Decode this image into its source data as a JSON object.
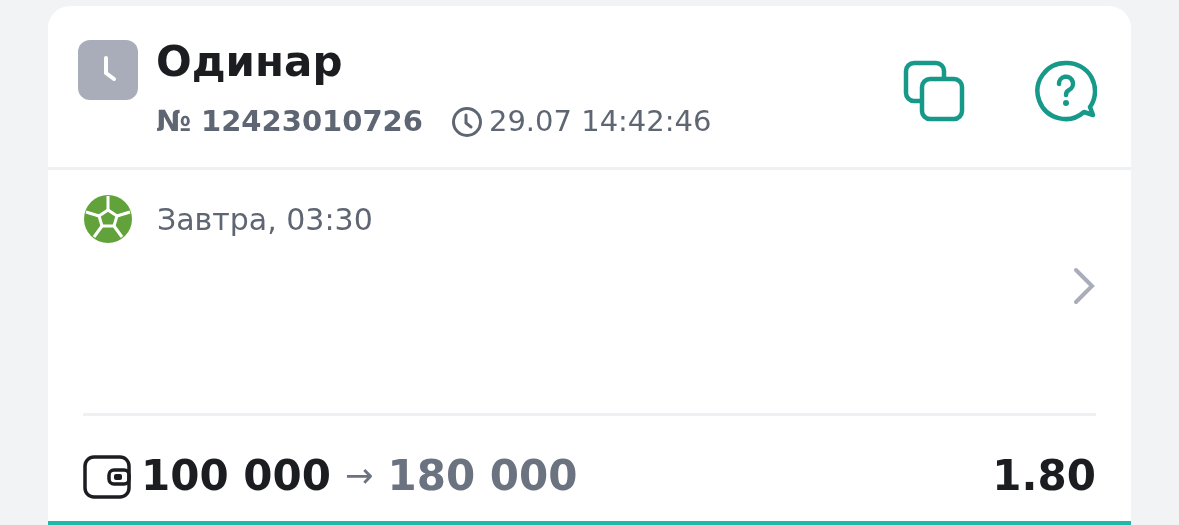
{
  "bet": {
    "type": "Одинар",
    "number": "№ 12423010726",
    "placed_at": "29.07 14:42:46"
  },
  "event": {
    "time": "Завтра, 03:30"
  },
  "footer": {
    "stake": "100 000",
    "arrow": "→",
    "payout": "180 000",
    "odds": "1.80"
  }
}
